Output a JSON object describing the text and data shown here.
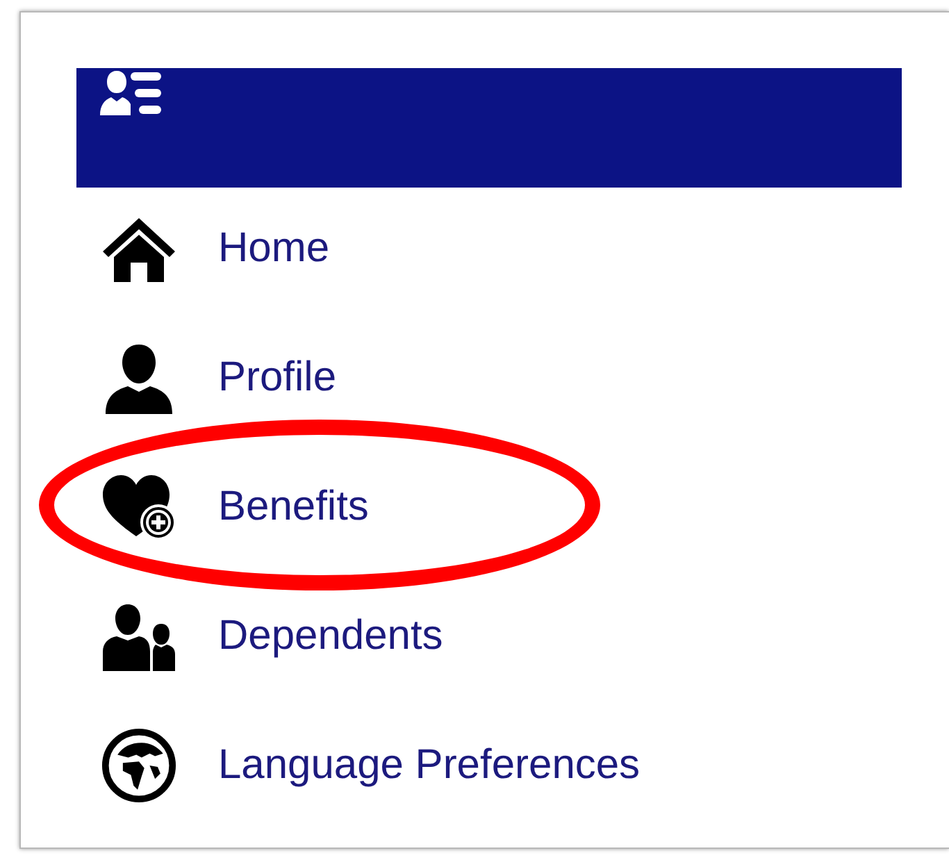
{
  "header": {
    "kind": "profile-list"
  },
  "menu": [
    {
      "label": "Home",
      "kind": "home",
      "circled": false
    },
    {
      "label": "Profile",
      "kind": "profile",
      "circled": false
    },
    {
      "label": "Benefits",
      "kind": "benefits",
      "circled": true
    },
    {
      "label": "Dependents",
      "kind": "dependents",
      "circled": false
    },
    {
      "label": "Language Preferences",
      "kind": "language",
      "circled": false
    }
  ]
}
